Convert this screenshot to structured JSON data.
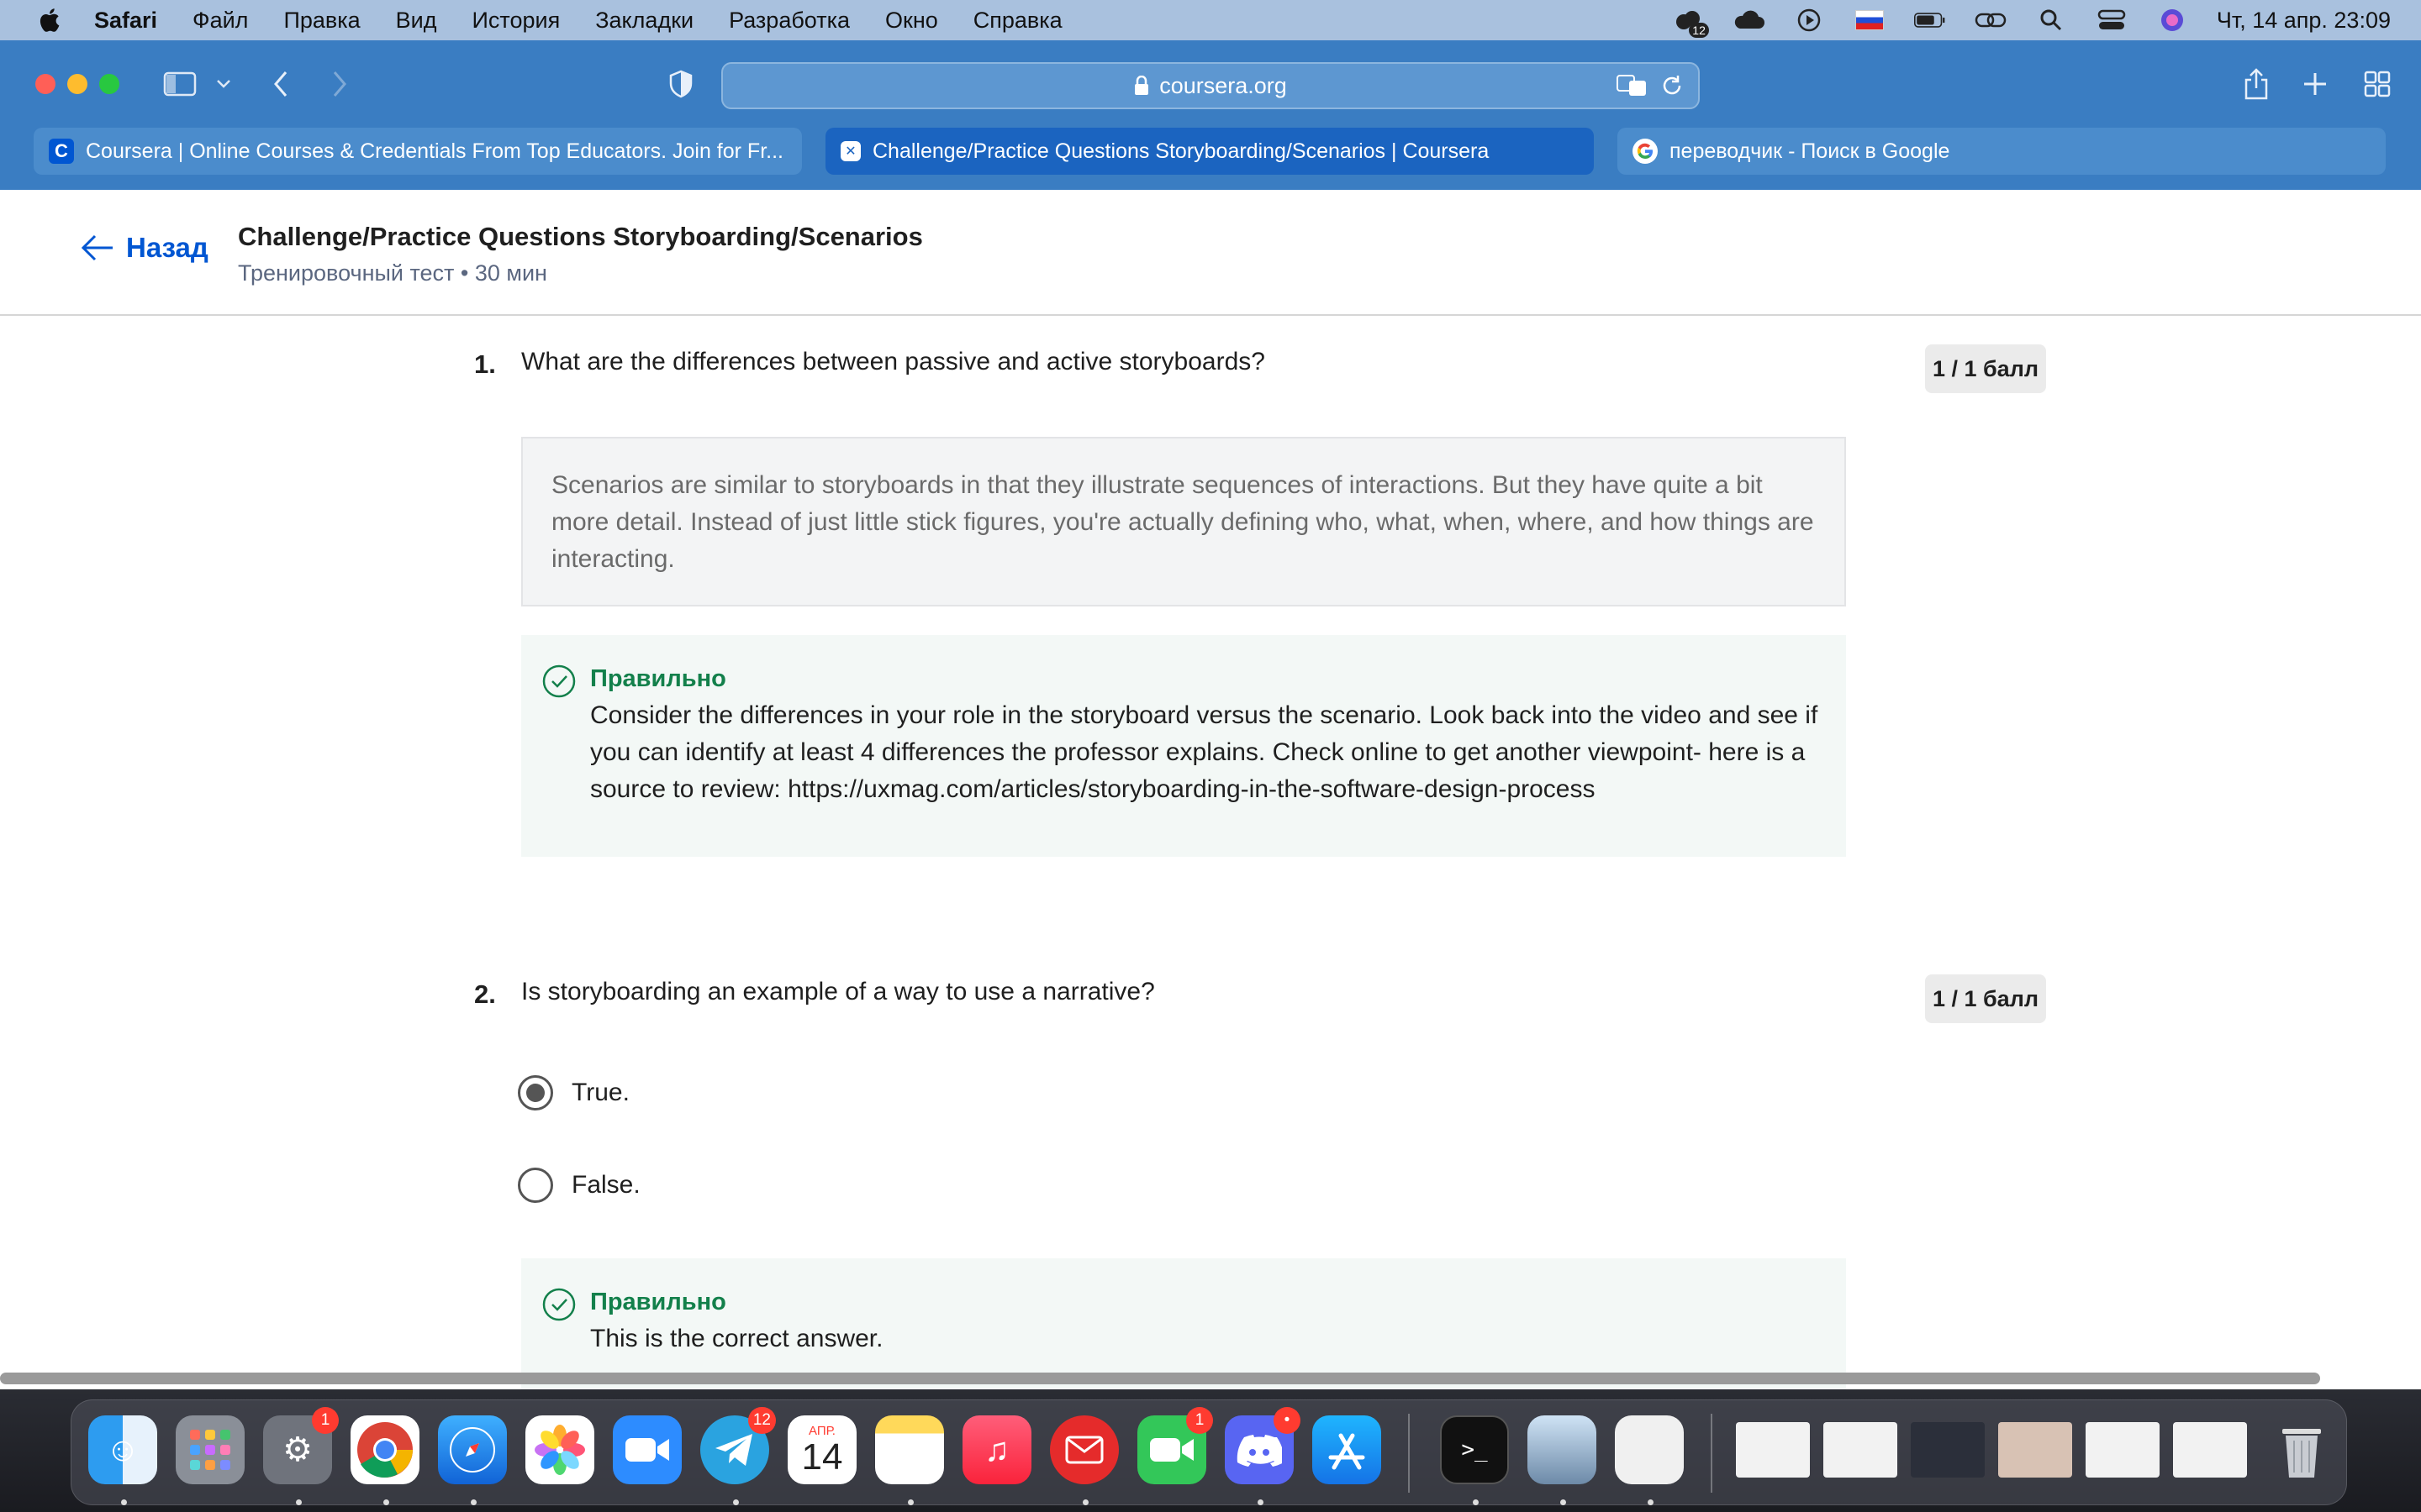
{
  "menubar": {
    "app": "Safari",
    "items": [
      "Файл",
      "Правка",
      "Вид",
      "История",
      "Закладки",
      "Разработка",
      "Окно",
      "Справка"
    ],
    "tray_badge": "12",
    "clock": "Чт, 14 апр.  23:09"
  },
  "browser": {
    "address": "coursera.org",
    "tabs": [
      {
        "label": "Coursera | Online Courses & Credentials From Top Educators. Join for Fr...",
        "icon": "coursera-icon"
      },
      {
        "label": "Challenge/Practice Questions Storyboarding/Scenarios | Coursera",
        "icon": "coursera-tab-icon"
      },
      {
        "label": "переводчик - Поиск в Google",
        "icon": "google-icon"
      }
    ]
  },
  "header": {
    "back_label": "Назад",
    "title": "Challenge/Practice Questions Storyboarding/Scenarios",
    "meta": "Тренировочный тест • 30 мин"
  },
  "questions": [
    {
      "number": "1.",
      "text": "What are the differences between passive and active storyboards?",
      "points": "1 / 1 балл",
      "answer": "Scenarios are similar to storyboards in that they illustrate sequences of interactions. But they have quite a bit more detail. Instead of just little stick figures, you're actually defining who, what, when, where, and how things are interacting.",
      "feedback_title": "Правильно",
      "feedback_text": "Consider the differences in your role in the storyboard versus the scenario. Look back into the video and see if you can identify at least 4 differences the professor explains. Check online to get another viewpoint- here is a source to review: https://uxmag.com/articles/storyboarding-in-the-software-design-process"
    },
    {
      "number": "2.",
      "text": "Is storyboarding an example of a way to use a narrative?",
      "points": "1 / 1 балл",
      "options": [
        {
          "label": "True.",
          "selected": true
        },
        {
          "label": "False.",
          "selected": false
        }
      ],
      "feedback_title": "Правильно",
      "feedback_text": "This is the correct answer."
    }
  ],
  "dock": {
    "badges": {
      "settings": "1",
      "telegram": "12",
      "facetime": "1",
      "discord": "•"
    },
    "calendar_month": "АПР.",
    "calendar_day": "14"
  },
  "colors": {
    "accent_blue": "#0056d2",
    "correct_green": "#13804b",
    "chrome_blue": "#3a7dc2"
  }
}
